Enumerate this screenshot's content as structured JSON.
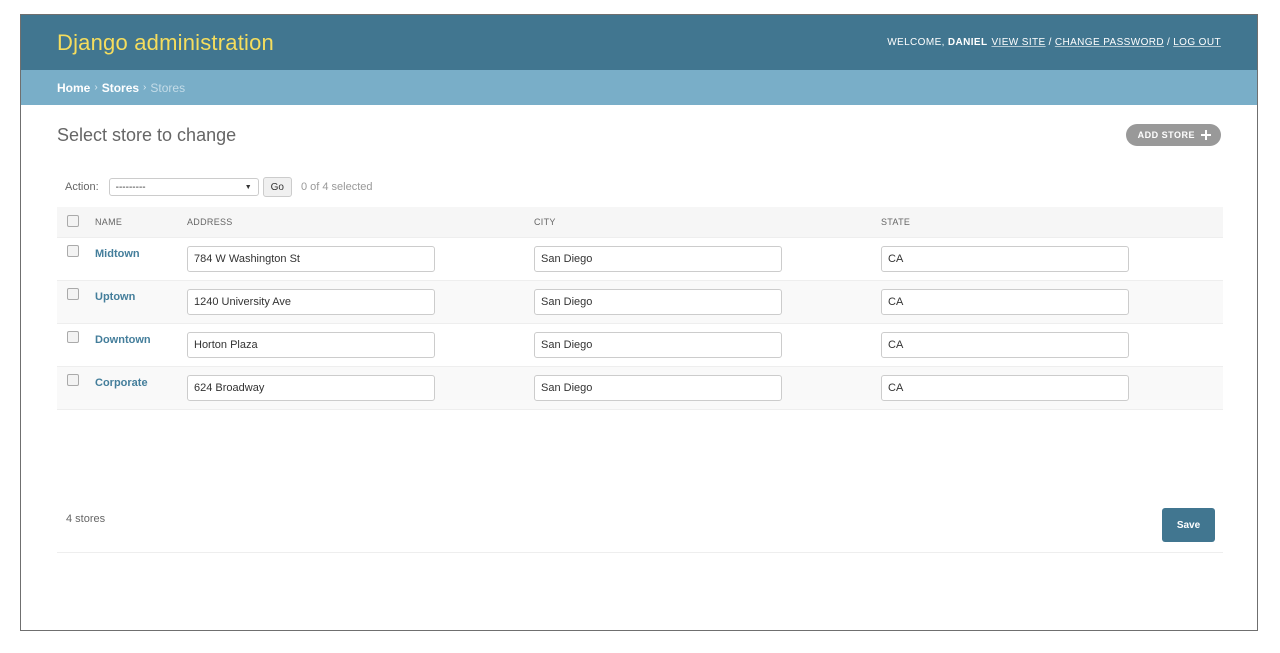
{
  "header": {
    "branding": "Django administration",
    "welcome": "WELCOME,",
    "username": "DANIEL",
    "view_site": "VIEW SITE",
    "separator": "/",
    "change_password": "CHANGE PASSWORD",
    "log_out": "LOG OUT"
  },
  "breadcrumbs": {
    "home": "Home",
    "app": "Stores",
    "current": "Stores",
    "separator": "›"
  },
  "page": {
    "title": "Select store to change",
    "add_button": "ADD STORE"
  },
  "actions": {
    "label": "Action:",
    "selected_option": "---------",
    "go_label": "Go",
    "counter": "0 of 4 selected"
  },
  "table": {
    "columns": [
      "NAME",
      "ADDRESS",
      "CITY",
      "STATE"
    ],
    "rows": [
      {
        "name": "Midtown",
        "address": "784 W Washington St",
        "city": "San Diego",
        "state": "CA"
      },
      {
        "name": "Uptown",
        "address": "1240 University Ave",
        "city": "San Diego",
        "state": "CA"
      },
      {
        "name": "Downtown",
        "address": "Horton Plaza",
        "city": "San Diego",
        "state": "CA"
      },
      {
        "name": "Corporate",
        "address": "624 Broadway",
        "city": "San Diego",
        "state": "CA"
      }
    ]
  },
  "footer": {
    "count": "4 stores",
    "save_label": "Save"
  },
  "colors": {
    "header_bg": "#417690",
    "branding_text": "#f5dd5d",
    "breadcrumb_bg": "#79aec8",
    "link": "#447e9b",
    "save_bg": "#417690"
  }
}
